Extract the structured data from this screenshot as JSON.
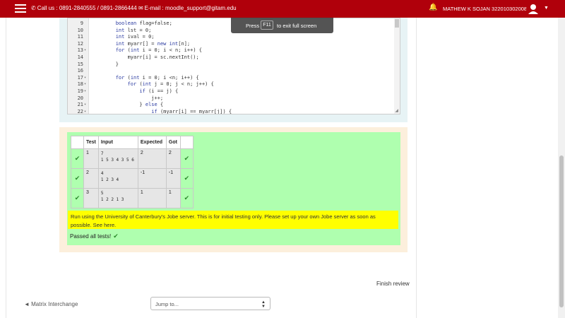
{
  "header": {
    "contact_text": "Call us : 0891-2840555 / 0891-2866444",
    "email_text": "E-mail : moodle_support@gitam.edu",
    "user_name": "MATHEW K SOJAN 322010302008"
  },
  "fullscreen_hint": {
    "press": "Press",
    "key": "F11",
    "rest": "to exit full screen"
  },
  "code_lines": [
    {
      "n": "9",
      "fold": "",
      "text": "        boolean flag=false;"
    },
    {
      "n": "10",
      "fold": "",
      "text": "        int lst = 0;"
    },
    {
      "n": "11",
      "fold": "",
      "text": "        int ival = 0;"
    },
    {
      "n": "12",
      "fold": "",
      "text": "        int myarr[] = new int[n];"
    },
    {
      "n": "13",
      "fold": "▾",
      "text": "        for (int i = 0; i < n; i++) {"
    },
    {
      "n": "14",
      "fold": "",
      "text": "            myarr[i] = sc.nextInt();"
    },
    {
      "n": "15",
      "fold": "",
      "text": "        }"
    },
    {
      "n": "16",
      "fold": "",
      "text": ""
    },
    {
      "n": "17",
      "fold": "▾",
      "text": "        for (int i = 0; i <n; i++) {"
    },
    {
      "n": "18",
      "fold": "▾",
      "text": "            for (int j = 0; j < n; j++) {"
    },
    {
      "n": "19",
      "fold": "▾",
      "text": "                if (i == j) {"
    },
    {
      "n": "20",
      "fold": "",
      "text": "                    j++;"
    },
    {
      "n": "21",
      "fold": "▾",
      "text": "                } else {"
    },
    {
      "n": "22",
      "fold": "▾",
      "text": "                    if (myarr[i] == myarr[j]) {"
    }
  ],
  "tests": {
    "headers": [
      "Test",
      "Input",
      "Expected",
      "Got"
    ],
    "rows": [
      {
        "test": "1",
        "input_line1": "7",
        "input_line2": "1 5 3 4 3 5 6",
        "expected": "2",
        "got": "2"
      },
      {
        "test": "2",
        "input_line1": "4",
        "input_line2": "1 2 3 4",
        "expected": "-1",
        "got": "-1"
      },
      {
        "test": "3",
        "input_line1": "5",
        "input_line2": "1 2 2 1 3",
        "expected": "1",
        "got": "1"
      }
    ]
  },
  "jobe_notice": "Run using the University of Canterbury's Jobe server. This is for initial testing only. Please set up your own Jobe server as soon as possible. See here.",
  "passed_text": "Passed all tests!",
  "nav": {
    "finish_review": "Finish review",
    "prev_activity": "◄ Matrix Interchange",
    "jump_placeholder": "Jump to..."
  }
}
